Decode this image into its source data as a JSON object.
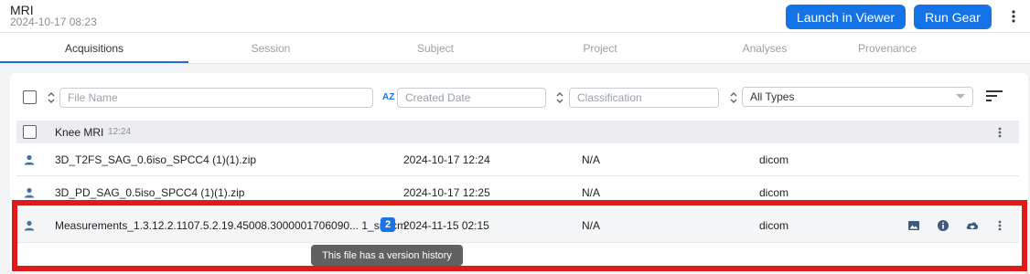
{
  "header": {
    "title": "MRI",
    "subtitle": "2024-10-17 08:23",
    "launch_label": "Launch in Viewer",
    "run_label": "Run Gear"
  },
  "tabs": [
    {
      "label": "Acquisitions",
      "active": true
    },
    {
      "label": "Session"
    },
    {
      "label": "Subject"
    },
    {
      "label": "Project"
    },
    {
      "label": "Analyses"
    },
    {
      "label": "Provenance"
    }
  ],
  "filters": {
    "file_name_placeholder": "File Name",
    "created_date_placeholder": "Created Date",
    "classification_placeholder": "Classification",
    "type_value": "All Types",
    "az_label": "AZ"
  },
  "group": {
    "name": "Knee MRI",
    "time": "12:24"
  },
  "rows": [
    {
      "name": "3D_T2FS_SAG_0.6iso_SPCC4 (1)(1).zip",
      "date": "2024-10-17 12:24",
      "classification": "N/A",
      "type": "dicom"
    },
    {
      "name": "3D_PD_SAG_0.5iso_SPCC4 (1)(1).zip",
      "date": "2024-10-17 12:25",
      "classification": "N/A",
      "type": "dicom"
    },
    {
      "name": "Measurements_1.3.12.2.1107.5.2.19.45008.3000001706090... 1_sr.dcm",
      "badge": "2",
      "date": "2024-11-15 02:15",
      "classification": "N/A",
      "type": "dicom"
    }
  ],
  "tooltip": "This file has a version history",
  "colors": {
    "primary": "#1473e6",
    "highlight": "#e01919",
    "badge": "#1a73e8"
  }
}
